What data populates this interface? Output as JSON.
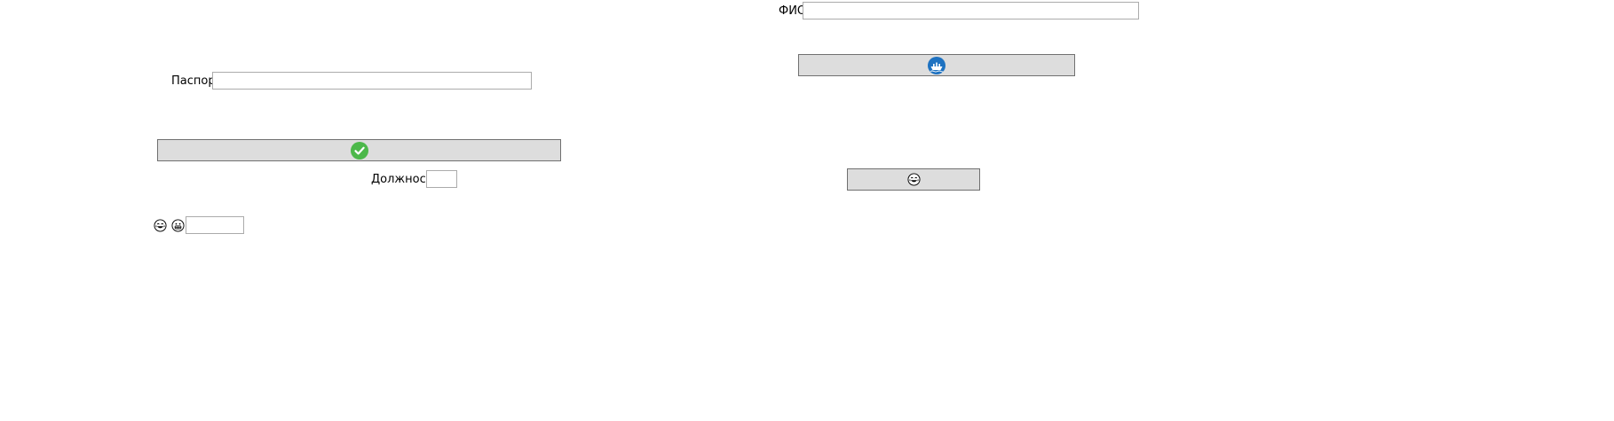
{
  "form": {
    "fio": {
      "label": "ФИО",
      "value": "",
      "placeholder": ""
    },
    "passport": {
      "label": "Паспорт",
      "value": "",
      "placeholder": ""
    },
    "position": {
      "label": "Должность",
      "value": "",
      "placeholder": ""
    },
    "small_field": {
      "value": "",
      "placeholder": ""
    }
  },
  "buttons": {
    "ship_button": {
      "icon": "ship-circle-icon",
      "icon_color": "#1e72c1"
    },
    "confirm_button": {
      "icon": "checkmark-circle-icon",
      "icon_color": "#4cb84a"
    },
    "emoji_button": {
      "icon": "laughing-face-icon"
    }
  },
  "emoji_row": {
    "icons": [
      "laughing-face-icon",
      "grinning-face-icon"
    ]
  },
  "colors": {
    "button_bg": "#dddddd",
    "button_border": "#707070",
    "field_border": "#ababab"
  }
}
